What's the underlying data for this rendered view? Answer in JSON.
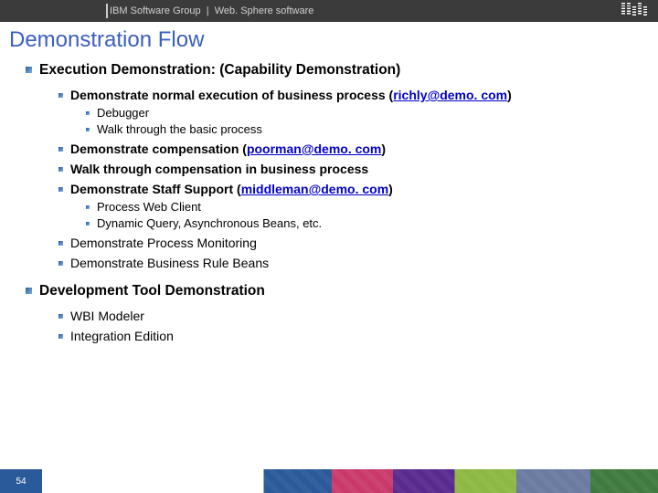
{
  "header": {
    "group": "IBM Software Group",
    "sep": "  |  ",
    "product": "Web. Sphere software"
  },
  "title": "Demonstration Flow",
  "sections": [
    {
      "heading": "Execution Demonstration:  (Capability Demonstration)",
      "items": [
        {
          "text": "Demonstrate normal execution of business process  (",
          "link": "richly@demo. com",
          "tail": ")",
          "bold": true,
          "sub": [
            {
              "text": "Debugger"
            },
            {
              "text": "Walk through the basic process"
            }
          ]
        },
        {
          "text": "Demonstrate compensation (",
          "link": "poorman@demo. com",
          "tail": ")",
          "bold": true
        },
        {
          "text": "Walk through compensation in business process",
          "bold": true
        },
        {
          "text": "Demonstrate Staff Support (",
          "link": "middleman@demo. com",
          "tail": ")",
          "bold": true,
          "sub": [
            {
              "text": "Process Web Client"
            },
            {
              "text": "Dynamic Query, Asynchronous Beans, etc."
            }
          ]
        },
        {
          "text": "Demonstrate Process Monitoring",
          "bold": false
        },
        {
          "text": "Demonstrate Business Rule Beans",
          "bold": false
        }
      ]
    },
    {
      "heading": "Development Tool Demonstration",
      "items": [
        {
          "text": "WBI Modeler",
          "bold": false
        },
        {
          "text": "Integration Edition",
          "bold": false
        }
      ]
    }
  ],
  "page_number": "54"
}
